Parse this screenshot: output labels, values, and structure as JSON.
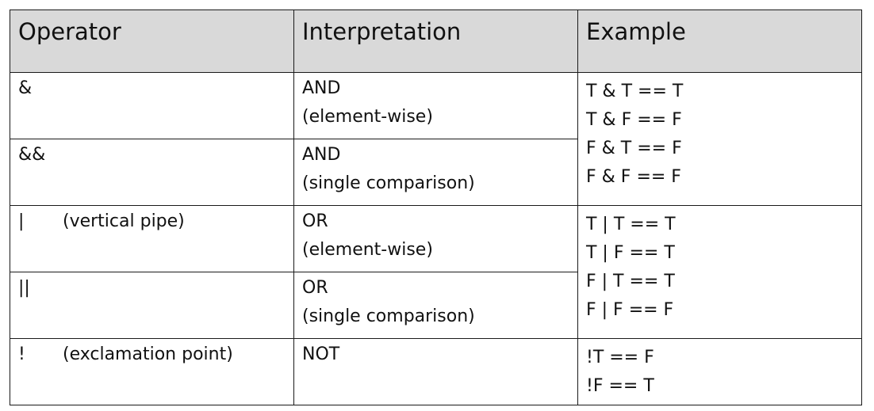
{
  "headers": [
    "Operator",
    "Interpretation",
    "Example"
  ],
  "rows": [
    {
      "operator": "&",
      "operator_note": "",
      "interp": [
        "AND",
        "(element-wise)"
      ]
    },
    {
      "operator": "&&",
      "operator_note": "",
      "interp": [
        "AND",
        "(single comparison)"
      ]
    },
    {
      "operator": "|",
      "operator_note": "(vertical pipe)",
      "interp": [
        "OR",
        "(element-wise)"
      ]
    },
    {
      "operator": "||",
      "operator_note": "",
      "interp": [
        "OR",
        "(single comparison)"
      ]
    },
    {
      "operator": "!",
      "operator_note": "(exclamation point)",
      "interp": [
        "NOT"
      ]
    }
  ],
  "examples": {
    "and": [
      "T & T == T",
      "T & F == F",
      "F & T == F",
      "F & F == F"
    ],
    "or": [
      "T | T == T",
      "T | F == T",
      "F | T == T",
      "F | F == F"
    ],
    "not": [
      "!T == F",
      "!F == T"
    ]
  }
}
